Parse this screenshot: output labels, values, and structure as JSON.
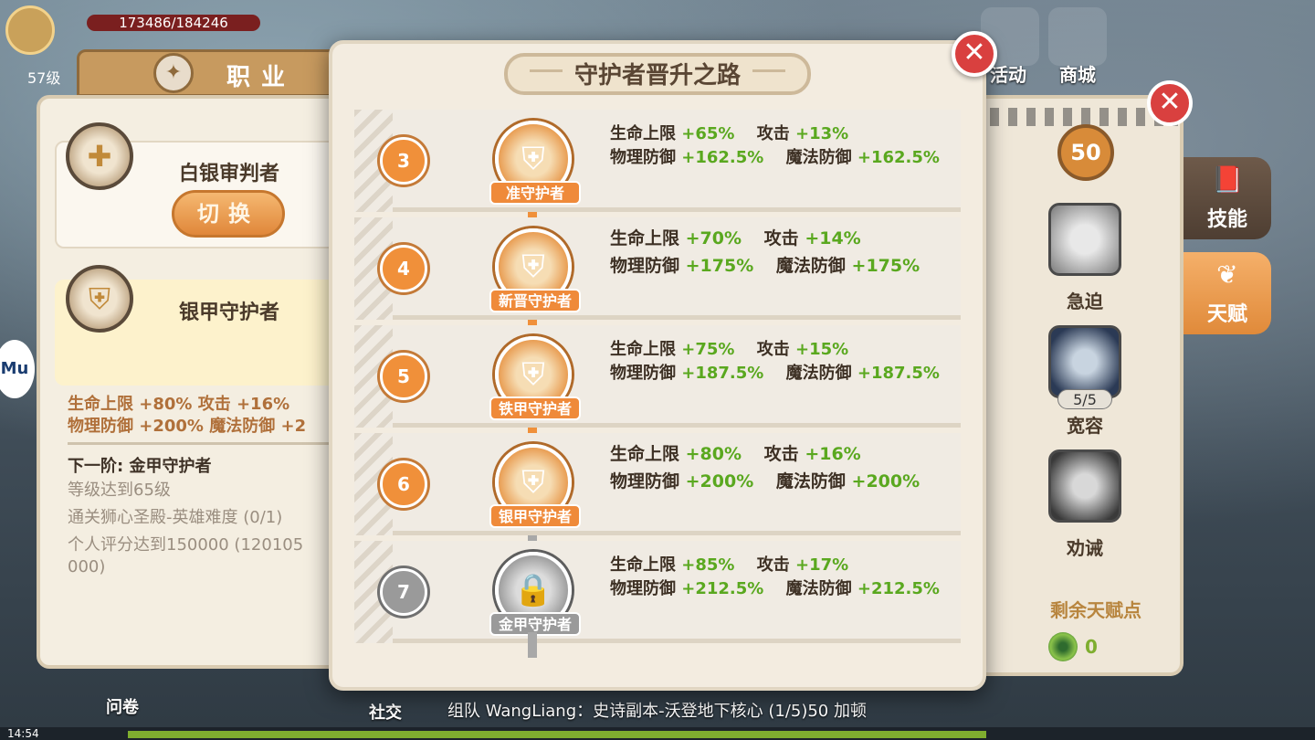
{
  "hud": {
    "hp_text": "173486/184246",
    "player_level": "57级",
    "top_labels": [
      "活动",
      "商城"
    ],
    "clock": "14:54",
    "chat_line": "组队  WangLiang：史诗副本-沃登地下核心 (1/5)50 加顿",
    "bottom_labels": [
      "问卷",
      "社交"
    ],
    "side_logo": "Mu"
  },
  "left_panel": {
    "tab_label": "职业",
    "class1": {
      "name": "白银审判者",
      "switch_label": "切换"
    },
    "class2": {
      "name": "银甲守护者"
    },
    "stats_line1": "生命上限 +80% 攻击 +16%",
    "stats_line2": "物理防御 +200% 魔法防御 +2",
    "next_tier": "下一阶: 金甲守护者",
    "req1": "等级达到65级",
    "req2": "通关狮心圣殿-英雄难度 (0/1)",
    "req3": "个人评分达到150000 (120105",
    "req3_cont": "000)"
  },
  "right_panel": {
    "level": "50",
    "skills_tab": "技能",
    "talent_tab": "天赋",
    "skills": [
      {
        "name": "急迫",
        "icon": "statue-face-icon"
      },
      {
        "name": "宽容",
        "icon": "holy-cross-icon",
        "count": "5/5"
      },
      {
        "name": "劝诫",
        "icon": "book-hand-icon"
      }
    ],
    "remaining_label": "剩余天赋点",
    "remaining_value": "0"
  },
  "modal": {
    "title": "守护者晋升之路",
    "close_icon": "close-icon",
    "tiers": [
      {
        "step": "3",
        "name": "准守护者",
        "unlocked": true,
        "hp_label": "生命上限",
        "hp": "+65%",
        "atk_label": "攻击",
        "atk": "+13%",
        "pdef_label": "物理防御",
        "pdef": "+162.5%",
        "mdef_label": "魔法防御",
        "mdef": "+162.5%"
      },
      {
        "step": "4",
        "name": "新晋守护者",
        "unlocked": true,
        "hp_label": "生命上限",
        "hp": "+70%",
        "atk_label": "攻击",
        "atk": "+14%",
        "pdef_label": "物理防御",
        "pdef": "+175%",
        "mdef_label": "魔法防御",
        "mdef": "+175%"
      },
      {
        "step": "5",
        "name": "铁甲守护者",
        "unlocked": true,
        "hp_label": "生命上限",
        "hp": "+75%",
        "atk_label": "攻击",
        "atk": "+15%",
        "pdef_label": "物理防御",
        "pdef": "+187.5%",
        "mdef_label": "魔法防御",
        "mdef": "+187.5%"
      },
      {
        "step": "6",
        "name": "银甲守护者",
        "unlocked": true,
        "hp_label": "生命上限",
        "hp": "+80%",
        "atk_label": "攻击",
        "atk": "+16%",
        "pdef_label": "物理防御",
        "pdef": "+200%",
        "mdef_label": "魔法防御",
        "mdef": "+200%"
      },
      {
        "step": "7",
        "name": "金甲守护者",
        "unlocked": false,
        "hp_label": "生命上限",
        "hp": "+85%",
        "atk_label": "攻击",
        "atk": "+17%",
        "pdef_label": "物理防御",
        "pdef": "+212.5%",
        "mdef_label": "魔法防御",
        "mdef": "+212.5%"
      }
    ]
  },
  "colors": {
    "accent_orange": "#f0903a",
    "stat_green": "#5aa81f",
    "locked_grey": "#9a9a9a",
    "close_red": "#d9403f"
  }
}
